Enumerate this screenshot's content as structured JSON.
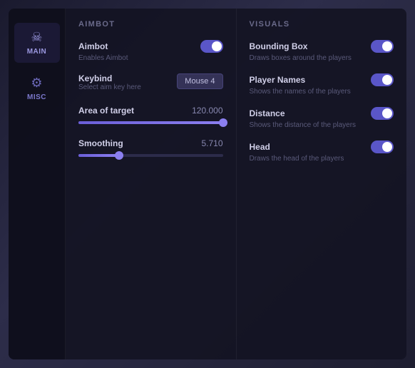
{
  "sidebar": {
    "items": [
      {
        "id": "main",
        "label": "MAIN",
        "icon": "☠",
        "active": true
      },
      {
        "id": "misc",
        "label": "MISC",
        "icon": "⚙",
        "active": false
      }
    ]
  },
  "aimbot": {
    "title": "AIMBOT",
    "settings": [
      {
        "id": "aimbot-toggle",
        "name": "Aimbot",
        "description": "Enables Aimbot",
        "type": "toggle",
        "enabled": true
      },
      {
        "id": "keybind",
        "name": "Keybind",
        "description": "Select aim key here",
        "type": "keybind",
        "value": "Mouse 4"
      },
      {
        "id": "area-of-target",
        "name": "Area of target",
        "description": "",
        "type": "slider",
        "value": "120.000",
        "fill_percent": 100
      },
      {
        "id": "smoothing",
        "name": "Smoothing",
        "description": "",
        "type": "slider",
        "value": "5.710",
        "fill_percent": 28
      }
    ]
  },
  "visuals": {
    "title": "VISUALS",
    "settings": [
      {
        "id": "bounding-box",
        "name": "Bounding Box",
        "description": "Draws boxes around the players",
        "type": "toggle",
        "enabled": true
      },
      {
        "id": "player-names",
        "name": "Player Names",
        "description": "Shows the names of the players",
        "type": "toggle",
        "enabled": true
      },
      {
        "id": "distance",
        "name": "Distance",
        "description": "Shows the distance of the players",
        "type": "toggle",
        "enabled": true
      },
      {
        "id": "head",
        "name": "Head",
        "description": "Draws the head of the players",
        "type": "toggle",
        "enabled": true
      }
    ]
  }
}
